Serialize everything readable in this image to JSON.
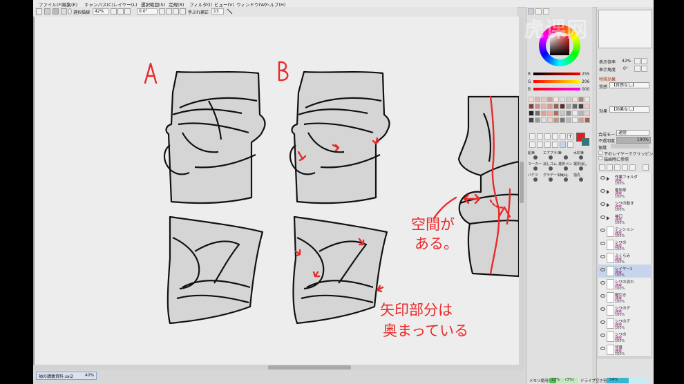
{
  "menu": [
    "ファイル(F)",
    "編集(E)",
    "キャンバス(C)",
    "レイヤー(L)",
    "選択範囲(S)",
    "定規(R)",
    "フィルタ(I)",
    "ビュー(V)",
    "ウィンドウ(W)",
    "ヘルプ(H)"
  ],
  "toolbar": {
    "select_label": "選択描線",
    "zoom_value": "42%",
    "angle_value": "0.0°",
    "stabilizer_label": "手ぶれ補正",
    "stabilizer_value": "13"
  },
  "canvas": {
    "label_a": "A",
    "label_b": "B",
    "note_space_1": "空間が",
    "note_space_2": "ある。",
    "note_arrow_1": "矢印部分は",
    "note_arrow_2": "奥まっている"
  },
  "file_tab": {
    "name": "袖の講義資料.sai2",
    "zoom": "40%"
  },
  "color_panel": {
    "r_label": "R",
    "r_value": "255",
    "g_label": "G",
    "g_value": "206",
    "b_label": "B",
    "b_value": "000",
    "accent": "#e02020"
  },
  "tools_panel": {
    "brush_labels": [
      "鉛筆",
      "エアブラシ",
      "筆",
      "水彩筆",
      "マーカー",
      "消しゴム",
      "選択ペン",
      "選択消し",
      "バケツ",
      "グラデーション",
      "ぼかし",
      "指先"
    ]
  },
  "navigator": {
    "zoom_label": "表示倍率",
    "zoom_value": "42%",
    "angle_label": "表示角度",
    "angle_value": "0°"
  },
  "effects": {
    "header": "特殊効果",
    "texture_label": "質感",
    "texture_value": "【質感なし】",
    "effect_label": "効果",
    "effect_value": "【効果なし】",
    "blend_label": "合成モード",
    "blend_value": "通常",
    "opacity_label": "不透明度",
    "opacity_value": "100%",
    "protect_label": "保護",
    "clip_label": "下のレイヤーでクリッピング",
    "ref_label": "描画時に参照"
  },
  "layers": [
    {
      "name": "作業フォルダ",
      "mode": "通常",
      "opacity": "100%",
      "kind": "folder"
    },
    {
      "name": "着彩部",
      "mode": "通常",
      "opacity": "100%",
      "kind": "folder"
    },
    {
      "name": "シワの動き",
      "mode": "通常",
      "opacity": "100%",
      "kind": "folder"
    },
    {
      "name": "袖口",
      "mode": "通常",
      "opacity": "100%",
      "kind": "folder"
    },
    {
      "name": "テンション",
      "mode": "通常",
      "opacity": "100%",
      "kind": "layer"
    },
    {
      "name": "シワの",
      "mode": "通常",
      "opacity": "100%",
      "kind": "layer"
    },
    {
      "name": "ふくらみ",
      "mode": "通常",
      "opacity": "100%",
      "kind": "layer"
    },
    {
      "name": "レイヤー1",
      "mode": "通常",
      "opacity": "100%",
      "kind": "layer",
      "selected": true
    },
    {
      "name": "シワの流れ",
      "mode": "通常",
      "opacity": "100%",
      "kind": "layer"
    },
    {
      "name": "鋸引き",
      "mode": "通常",
      "opacity": "100%",
      "kind": "layer"
    },
    {
      "name": "シワのデ",
      "mode": "通常",
      "opacity": "100%",
      "kind": "layer"
    },
    {
      "name": "シワのデ",
      "mode": "通常",
      "opacity": "100%",
      "kind": "layer"
    },
    {
      "name": "シワの",
      "mode": "通常",
      "opacity": "100%",
      "kind": "layer"
    },
    {
      "name": "背景",
      "mode": "通常",
      "opacity": "100%",
      "kind": "layer"
    }
  ],
  "status": {
    "memory_label": "メモリ使用量",
    "memory_value": "22%",
    "memory_value2": "(3%)",
    "drive_label": "ドライブ空き容量",
    "drive_value": "54%"
  },
  "watermark": "虎课网"
}
